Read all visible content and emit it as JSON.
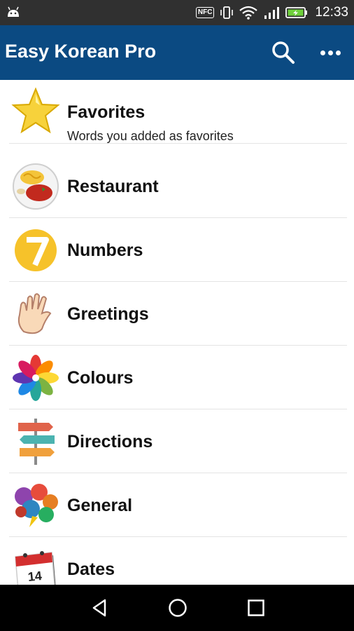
{
  "status_bar": {
    "nfc_label": "NFC",
    "time": "12:33",
    "icons": [
      "android-debug-icon",
      "nfc-icon",
      "vibrate-icon",
      "wifi-icon",
      "signal-icon",
      "battery-charging-icon"
    ]
  },
  "app_bar": {
    "title": "Easy Korean Pro",
    "color": "#0b4a82",
    "actions": [
      "search-icon",
      "more-options-icon"
    ]
  },
  "categories": [
    {
      "title": "Favorites",
      "subtitle": "Words you added as favorites",
      "icon": "star-icon"
    },
    {
      "title": "Restaurant",
      "icon": "plate-of-food-icon"
    },
    {
      "title": "Numbers",
      "icon": "number-seven-icon"
    },
    {
      "title": "Greetings",
      "icon": "waving-hand-icon"
    },
    {
      "title": "Colours",
      "icon": "color-wheel-icon"
    },
    {
      "title": "Directions",
      "icon": "signpost-icon"
    },
    {
      "title": "General",
      "icon": "speech-bubbles-icon"
    },
    {
      "title": "Dates",
      "icon": "calendar-icon",
      "calendar_day": "14"
    }
  ],
  "nav_bar": {
    "buttons": [
      "back-icon",
      "home-icon",
      "recents-icon"
    ]
  }
}
